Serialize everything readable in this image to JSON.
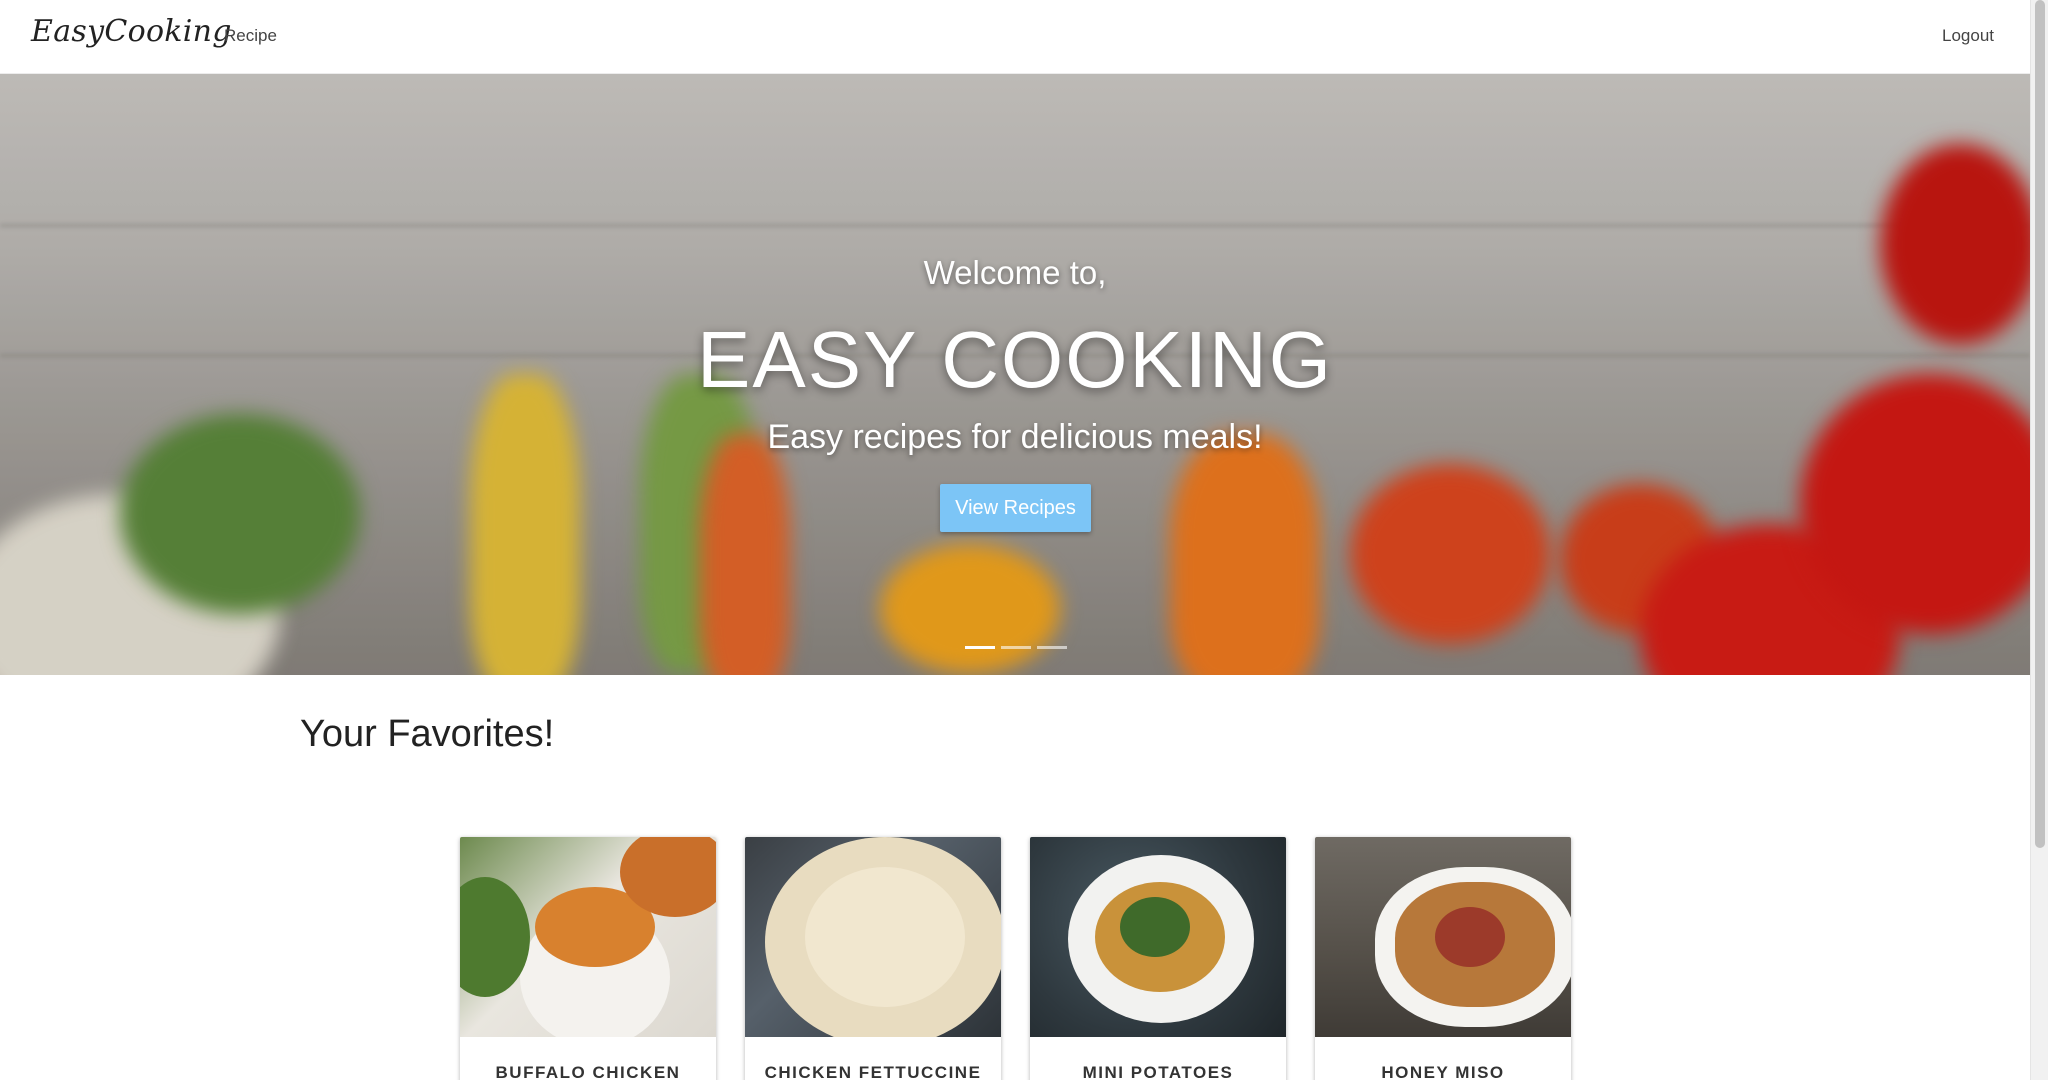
{
  "navbar": {
    "brand": "EasyCooking",
    "recipe_link": "Recipe",
    "logout_link": "Logout"
  },
  "hero": {
    "welcome": "Welcome to,",
    "title": "EASY COOKING",
    "subtitle": "Easy recipes for delicious meals!",
    "button_label": "View Recipes",
    "slide_count": 3,
    "active_slide": 1
  },
  "favorites": {
    "heading": "Your Favorites!",
    "cards": [
      {
        "title": "BUFFALO CHICKEN"
      },
      {
        "title": "CHICKEN FETTUCCINE"
      },
      {
        "title": "MINI POTATOES"
      },
      {
        "title": "HONEY MISO"
      }
    ]
  },
  "colors": {
    "accent_button": "#7cc5f6",
    "nav_background": "#ffffff"
  }
}
